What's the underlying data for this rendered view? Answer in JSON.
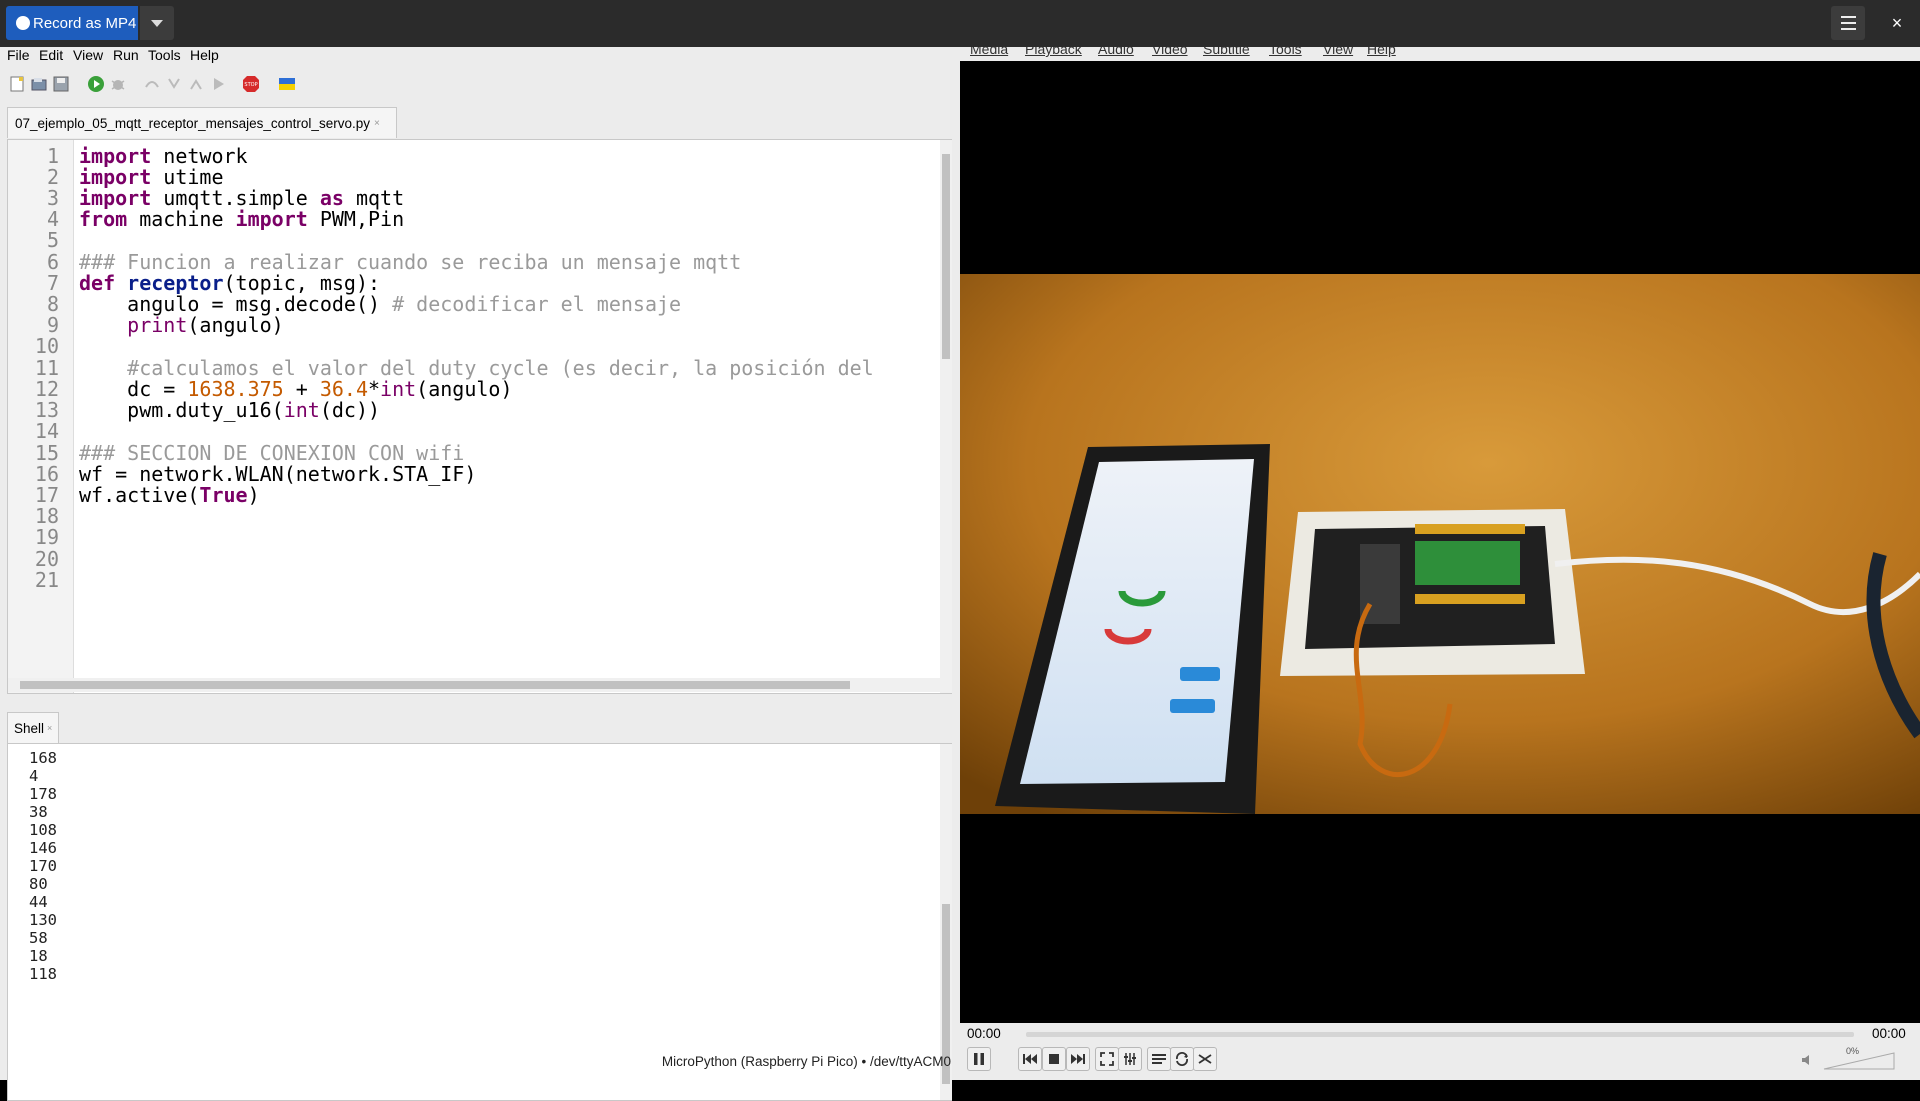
{
  "recorder": {
    "record_label": "Record as MP4",
    "close_label": "×"
  },
  "thonny": {
    "menu": [
      "File",
      "Edit",
      "View",
      "Run",
      "Tools",
      "Help"
    ],
    "tab_filename": "07_ejemplo_05_mqtt_receptor_mensajes_control_servo.py",
    "tab_close": "×",
    "line_numbers": [
      "1",
      "2",
      "3",
      "4",
      "5",
      "6",
      "7",
      "8",
      "9",
      "10",
      "11",
      "12",
      "13",
      "14",
      "15",
      "16",
      "17",
      "18",
      "19",
      "20",
      "21"
    ],
    "code": {
      "l1_kw": "import",
      "l1_rest": " network",
      "l2_kw": "import",
      "l2_rest": " utime",
      "l3_kw": "import",
      "l3_mid": " umqtt.simple ",
      "l3_kw2": "as",
      "l3_rest": " mqtt",
      "l4_kw": "from",
      "l4_mid": " machine ",
      "l4_kw2": "import",
      "l4_rest": " PWM,Pin",
      "l6_cm": "### Funcion a realizar cuando se reciba un mensaje mqtt",
      "l7_kw": "def",
      "l7_sp": " ",
      "l7_fn": "receptor",
      "l7_rest": "(topic, msg):",
      "l8_code": "    angulo = msg.decode() ",
      "l8_cm": "# decodificar el mensaje",
      "l9_ind": "    ",
      "l9_bi": "print",
      "l9_rest": "(angulo)",
      "l11_cm": "    #calculamos el valor del duty cycle (es decir, la posición del",
      "l12_a": "    dc = ",
      "l12_n1": "1638.375",
      "l12_b": " + ",
      "l12_n2": "36.4",
      "l12_c": "*",
      "l12_bi": "int",
      "l12_d": "(angulo)",
      "l13_a": "    pwm.duty_u16(",
      "l13_bi": "int",
      "l13_b": "(dc))",
      "l15_cm": "### SECCION DE CONEXION CON wifi",
      "l16": "wf = network.WLAN(network.STA_IF)",
      "l17_a": "wf.active(",
      "l17_kw": "True",
      "l17_b": ")"
    },
    "shell_tab": "Shell",
    "shell_close": "×",
    "shell_lines": [
      "168",
      "4",
      "178",
      "38",
      "108",
      "146",
      "170",
      "80",
      "44",
      "130",
      "58",
      "18",
      "118"
    ],
    "status": "MicroPython (Raspberry Pi Pico)  •  /dev/ttyACM0"
  },
  "vlc": {
    "menu": [
      "Media",
      "Playback",
      "Audio",
      "Video",
      "Subtitle",
      "Tools",
      "View",
      "Help"
    ],
    "time_elapsed": "00:00",
    "time_total": "00:00",
    "volume": "0%"
  },
  "colors": {
    "accent": "#1e5dbd",
    "keyword": "#7a0066",
    "number": "#c45a00",
    "comment": "#9a9a9a"
  }
}
